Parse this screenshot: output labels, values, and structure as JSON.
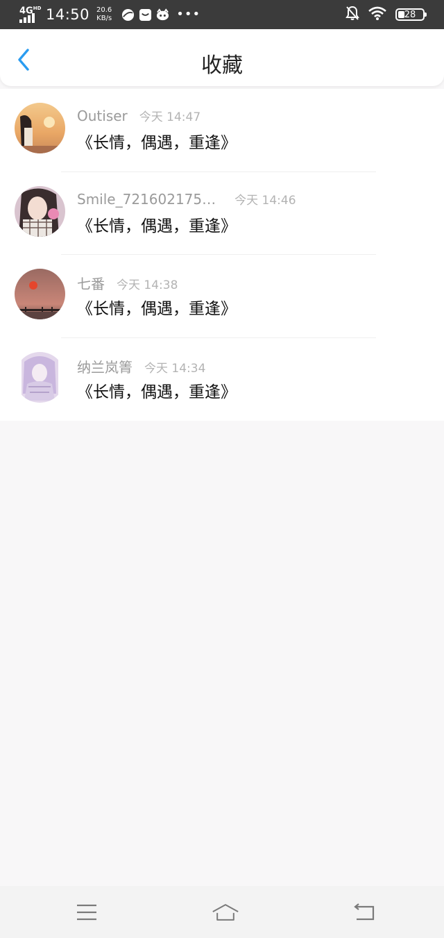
{
  "status_bar": {
    "network": "4G",
    "network_sup": "HD",
    "time": "14:50",
    "speed_value": "20.6",
    "speed_unit": "KB/s",
    "battery": "28",
    "icons": [
      "browser-icon",
      "message-icon",
      "cat-app-icon",
      "more-dots",
      "bell-off-icon",
      "wifi-icon",
      "battery-icon"
    ]
  },
  "header": {
    "title": "收藏",
    "back_icon": "chevron-left-icon",
    "accent_color": "#2a9cf0"
  },
  "favorites": [
    {
      "name": "Outiser",
      "time": "今天 14:47",
      "content": "《长情，偶遇，重逢》"
    },
    {
      "name": "Smile_721602175…",
      "time": "今天 14:46",
      "content": "《长情，偶遇，重逢》"
    },
    {
      "name": "七番",
      "time": "今天 14:38",
      "content": "《长情，偶遇，重逢》"
    },
    {
      "name": "纳兰岚箐",
      "time": "今天 14:34",
      "content": "《长情，偶遇，重逢》"
    }
  ],
  "nav_bar": {
    "icons": [
      "menu-icon",
      "home-icon",
      "back-icon"
    ]
  }
}
